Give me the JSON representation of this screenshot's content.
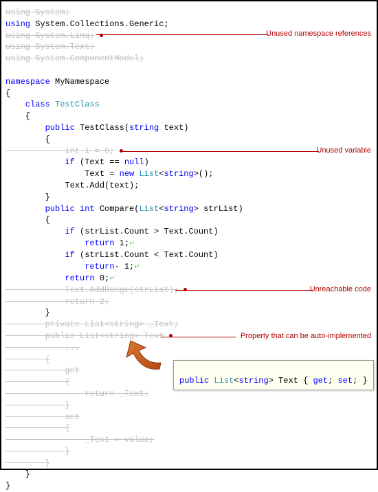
{
  "code": {
    "l1_using": "using",
    "l1_ns": " System;",
    "l2_using": "using",
    "l2_ns": " System.Collections.Generic;",
    "l3": "using System.Linq;",
    "l4": "using System.Text;",
    "l5": "using System.ComponentModel;",
    "l6": "",
    "l7_ns": "namespace",
    "l7_name": " MyNamespace",
    "l8": "{",
    "l9_cls": "    class",
    "l9_name": " TestClass",
    "l10": "    {",
    "l11_mod": "        public",
    "l11_name": " TestClass(",
    "l11_type": "string",
    "l11_rest": " text)",
    "l12": "        {",
    "l13": "            int i = 0;",
    "l14_if": "            if",
    "l14_cond": " (Text == ",
    "l14_null": "null",
    "l14_close": ")",
    "l15_a": "                Text = ",
    "l15_new": "new",
    "l15_b": " ",
    "l15_type": "List",
    "l15_c": "<",
    "l15_str": "string",
    "l15_d": ">();",
    "l16": "            Text.Add(text);",
    "l17": "        }",
    "l18_mod": "        public",
    "l18_ret": " int",
    "l18_name": " Compare(",
    "l18_type": "List",
    "l18_a": "<",
    "l18_str": "string",
    "l18_b": "> strList)",
    "l19": "        {",
    "l20_if": "            if",
    "l20_rest": " (strList.Count > Text.Count)",
    "l21_ret": "                return",
    "l21_val": " 1;",
    "l22_if": "            if",
    "l22_rest": " (strList.Count < Text.Count)",
    "l23_ret": "                return",
    "l23_val": "- 1;",
    "l24_ret": "            return",
    "l24_val": " 0;",
    "l25": "            Text.AddRange(strList);",
    "l26": "            return 2;",
    "l27": "        }",
    "l28": "        private List<string> _Text;",
    "l29": "        public List<string> Text",
    "l30": "        {",
    "l31": "            get",
    "l32": "            {",
    "l33": "                return _Text;",
    "l34": "            }",
    "l35": "            set",
    "l36": "            {",
    "l37": "                _Text = value;",
    "l38": "            }",
    "l39": "        }",
    "l40": "    }",
    "l41": "}",
    "dots": "            ..."
  },
  "annotations": {
    "unused_ns": "Unused namespace references",
    "unused_var": "Unused variable",
    "unreachable": "Unreachable code",
    "auto_prop": "Property that can be auto-implemented"
  },
  "tooltip": {
    "mod": "public",
    "sp1": " ",
    "type": "List",
    "a": "<",
    "str": "string",
    "b": "> Text { ",
    "get": "get",
    "c": "; ",
    "set": "set",
    "d": "; }"
  }
}
